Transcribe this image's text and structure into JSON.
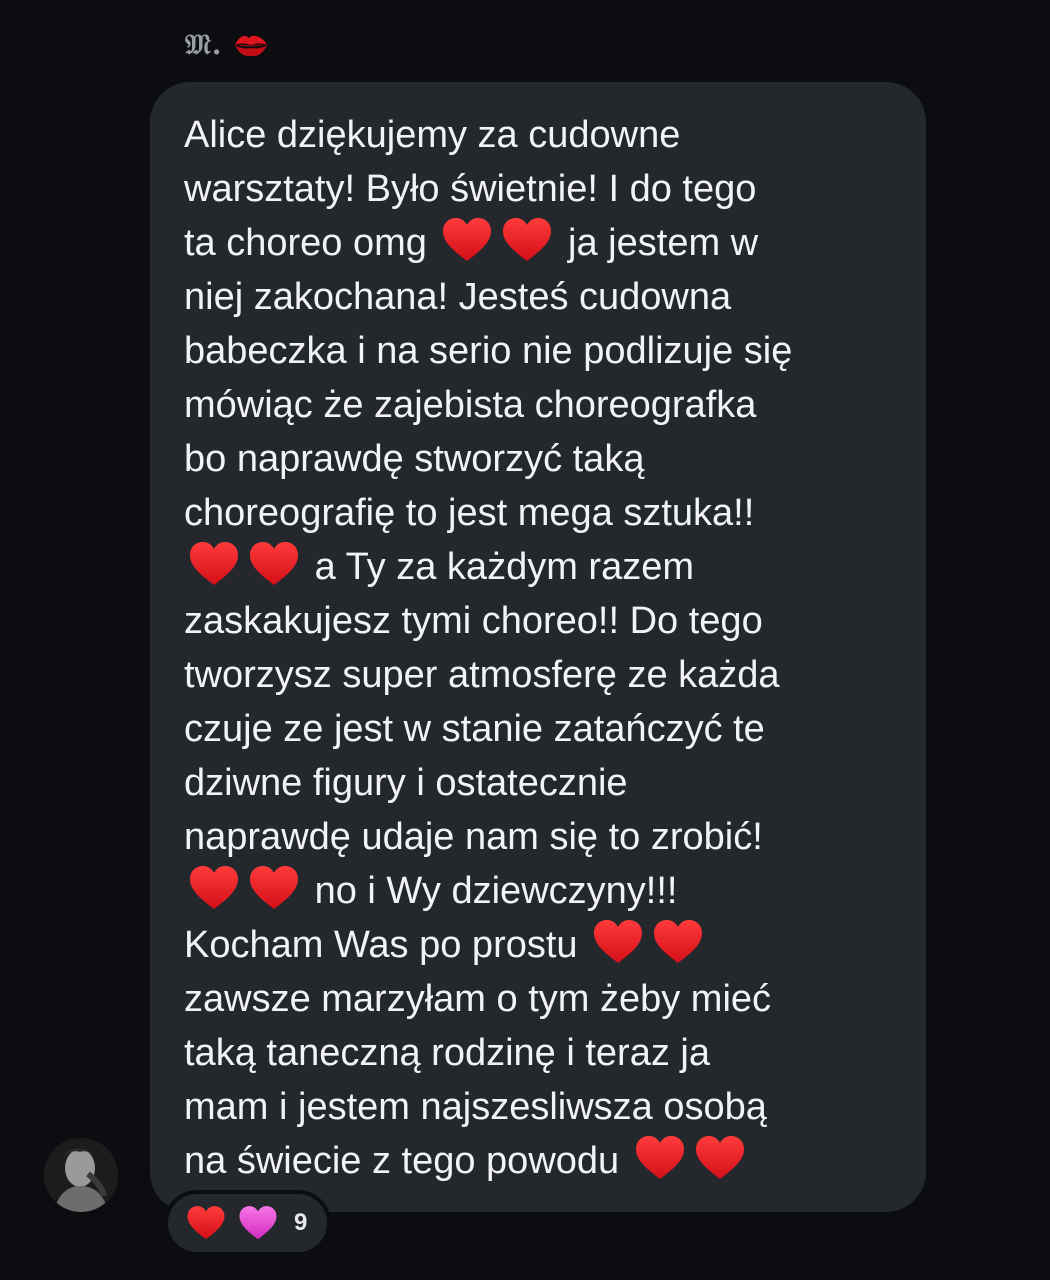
{
  "sender": {
    "name": "𝔐.",
    "emoji_icon": "kiss-mark-icon"
  },
  "message": {
    "lines": [
      "Alice dziękujemy za cudowne",
      "warsztaty! Było świetnie! I do tego",
      "ta choreo omg",
      "ja jestem w",
      "niej zakochana! Jesteś cudowna",
      "babeczka i na serio nie podlizuje się",
      "mówiąc że zajebista choreografka",
      "bo naprawdę stworzyć taką",
      "choreografię to jest mega sztuka!!",
      "a Ty za każdym razem",
      "zaskakujesz tymi choreo!! Do tego",
      "tworzysz super atmosferę ze każda",
      "czuje ze jest w stanie zatańczyć te",
      "dziwne figury i ostatecznie",
      "naprawdę udaje nam się to zrobić!",
      "no i Wy dziewczyny!!!",
      "Kocham Was po prostu",
      "zawsze marzyłam o tym żeby mieć",
      "taką taneczną rodzinę i teraz ja",
      "mam i jestem najszesliwsza osobą",
      "na świecie z tego powodu"
    ],
    "heart_emoji": "red-heart-icon"
  },
  "reactions": {
    "emojis": [
      "red-heart-icon",
      "pink-heart-icon"
    ],
    "count": "9"
  },
  "colors": {
    "background": "#0b0d10",
    "bubble": "#24272c",
    "text": "#f2f3f5",
    "sender": "#9a9da3",
    "heart_red": "#e0141e",
    "heart_pink": "#e24ad0"
  }
}
